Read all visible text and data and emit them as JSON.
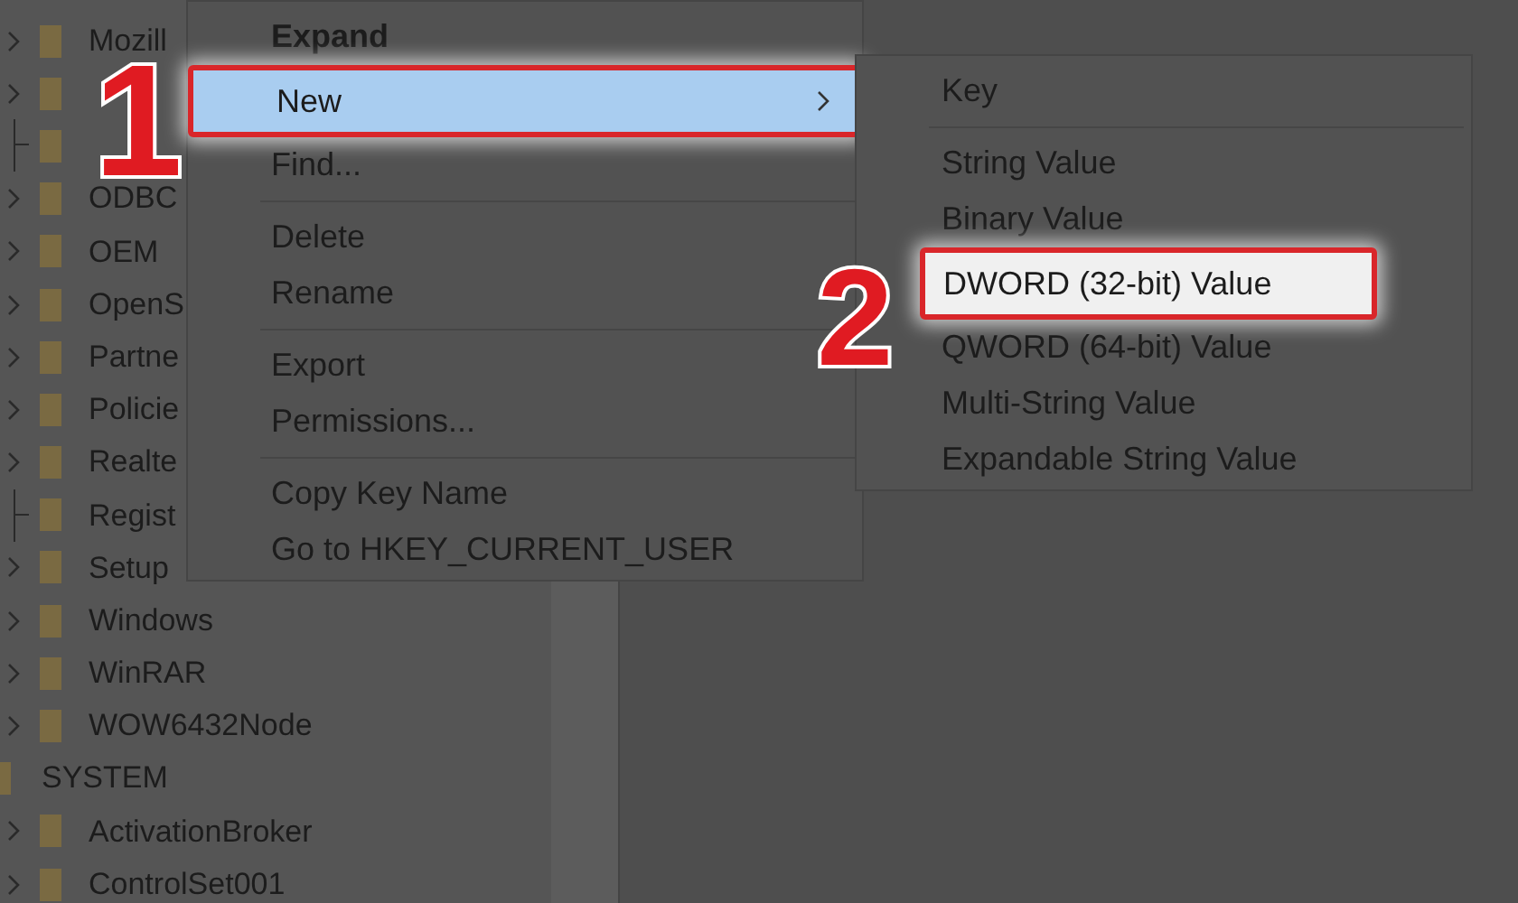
{
  "tree": {
    "items": [
      {
        "children": [
          {
            "label": "Mozill",
            "has_children": true
          },
          {
            "has_children": true
          },
          {
            "has_children": false
          },
          {
            "label": "ODBC",
            "has_children": true
          },
          {
            "label": "OEM",
            "has_children": true
          },
          {
            "label": "OpenS",
            "has_children": true
          },
          {
            "label": "Partne",
            "has_children": true
          },
          {
            "label": "Policie",
            "has_children": true
          },
          {
            "label": "Realte",
            "has_children": true
          },
          {
            "label": "Regist",
            "has_children": false
          },
          {
            "label": "Setup",
            "has_children": true
          },
          {
            "label": "Windows",
            "has_children": true
          },
          {
            "label": "WinRAR",
            "has_children": true
          },
          {
            "label": "WOW6432Node",
            "has_children": true
          }
        ]
      },
      {
        "label": "SYSTEM",
        "has_children": true,
        "children": [
          {
            "label": "ActivationBroker",
            "has_children": true
          },
          {
            "label": "ControlSet001",
            "has_children": true
          }
        ]
      }
    ]
  },
  "context_menu": {
    "items": [
      {
        "kind": "item",
        "label": "Expand",
        "bold": true,
        "selected": false
      },
      {
        "kind": "item",
        "label": "New",
        "submenu": true,
        "selected": true
      },
      {
        "kind": "item",
        "label": "Find...",
        "selected": false
      },
      {
        "kind": "separator"
      },
      {
        "kind": "item",
        "label": "Delete",
        "selected": false
      },
      {
        "kind": "item",
        "label": "Rename",
        "selected": false
      },
      {
        "kind": "separator"
      },
      {
        "kind": "item",
        "label": "Export",
        "selected": false
      },
      {
        "kind": "item",
        "label": "Permissions...",
        "selected": false
      },
      {
        "kind": "separator"
      },
      {
        "kind": "item",
        "label": "Copy Key Name",
        "selected": false
      },
      {
        "kind": "item",
        "label": "Go to HKEY_CURRENT_USER",
        "selected": false
      }
    ]
  },
  "submenu": {
    "items": [
      {
        "kind": "item",
        "label": "Key",
        "selected": false
      },
      {
        "kind": "separator"
      },
      {
        "kind": "item",
        "label": "String Value",
        "selected": false
      },
      {
        "kind": "item",
        "label": "Binary Value",
        "selected": false
      },
      {
        "kind": "item",
        "label": "DWORD (32-bit) Value",
        "selected": true
      },
      {
        "kind": "item",
        "label": "QWORD (64-bit) Value",
        "selected": false
      },
      {
        "kind": "item",
        "label": "Multi-String Value",
        "selected": false
      },
      {
        "kind": "item",
        "label": "Expandable String Value",
        "selected": false
      }
    ]
  },
  "callouts": [
    {
      "text": "1"
    },
    {
      "text": "2"
    }
  ]
}
